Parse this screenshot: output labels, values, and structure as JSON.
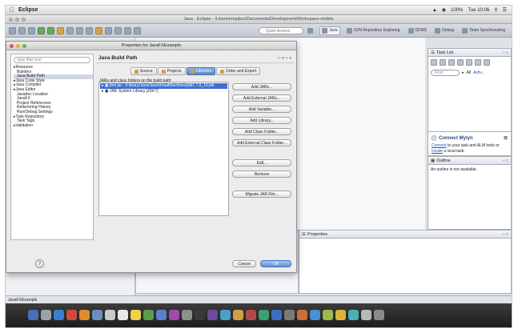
{
  "menubar": {
    "app": "Eclipse",
    "status": [
      "100%",
      "Tue 10:06"
    ]
  },
  "window": {
    "title": "Java - Eclipse - /Users/emailsrc/Documents/Development/Workspace-mobile"
  },
  "toolbar": {
    "quick_access_placeholder": "Quick Access",
    "perspectives": [
      "Java",
      "SVN Repository Exploring",
      "DDMS",
      "Debug",
      "Team Synchronizing"
    ]
  },
  "dialog": {
    "title": "Properties for JavaFXExample",
    "filter_placeholder": "type filter text",
    "tree": [
      {
        "label": "Resource",
        "expandable": true
      },
      {
        "label": "Builders",
        "expandable": false
      },
      {
        "label": "Java Build Path",
        "expandable": false,
        "selected": true
      },
      {
        "label": "Java Code Style",
        "expandable": true
      },
      {
        "label": "Java Compiler",
        "expandable": true
      },
      {
        "label": "Java Editor",
        "expandable": true
      },
      {
        "label": "Javadoc Location",
        "expandable": false
      },
      {
        "label": "JavaFX",
        "expandable": false
      },
      {
        "label": "Project References",
        "expandable": false
      },
      {
        "label": "Refactoring History",
        "expandable": false
      },
      {
        "label": "Run/Debug Settings",
        "expandable": false
      },
      {
        "label": "Task Repository",
        "expandable": true
      },
      {
        "label": "Task Tags",
        "expandable": false
      },
      {
        "label": "Validation",
        "expandable": true
      }
    ],
    "heading": "Java Build Path",
    "tabs": [
      "Source",
      "Projects",
      "Libraries",
      "Order and Export"
    ],
    "caption": "JARs and class folders on the build path:",
    "libraries": [
      "jfxrt.jar - /Library/Java/JavaVirtualMachines/jdk1.7.0_10.jdk",
      "JRE System Library [JDK7]"
    ],
    "buttons": {
      "add_jars": "Add JARs...",
      "add_external_jars": "Add External JARs...",
      "add_variable": "Add Variable...",
      "add_library": "Add Library...",
      "add_class_folder": "Add Class Folder...",
      "add_external_class_folder": "Add External Class Folder...",
      "edit": "Edit...",
      "remove": "Remove",
      "migrate_jar": "Migrate JAR File..."
    },
    "help": "?",
    "cancel": "Cancel",
    "ok": "OK"
  },
  "tasklist": {
    "title": "Task List",
    "find_placeholder": "Find",
    "all": "All",
    "activate": "Activ..."
  },
  "mylyn": {
    "title": "Connect Mylyn",
    "connect_link": "Connect",
    "mid_text": " to your task and ALM tools or ",
    "create_link": "create",
    "end_text": " a local task."
  },
  "outline": {
    "title": "Outline",
    "message": "An outline is not available."
  },
  "properties": {
    "title": "Properties"
  },
  "statusbar": {
    "text": "JavaFXExample"
  }
}
